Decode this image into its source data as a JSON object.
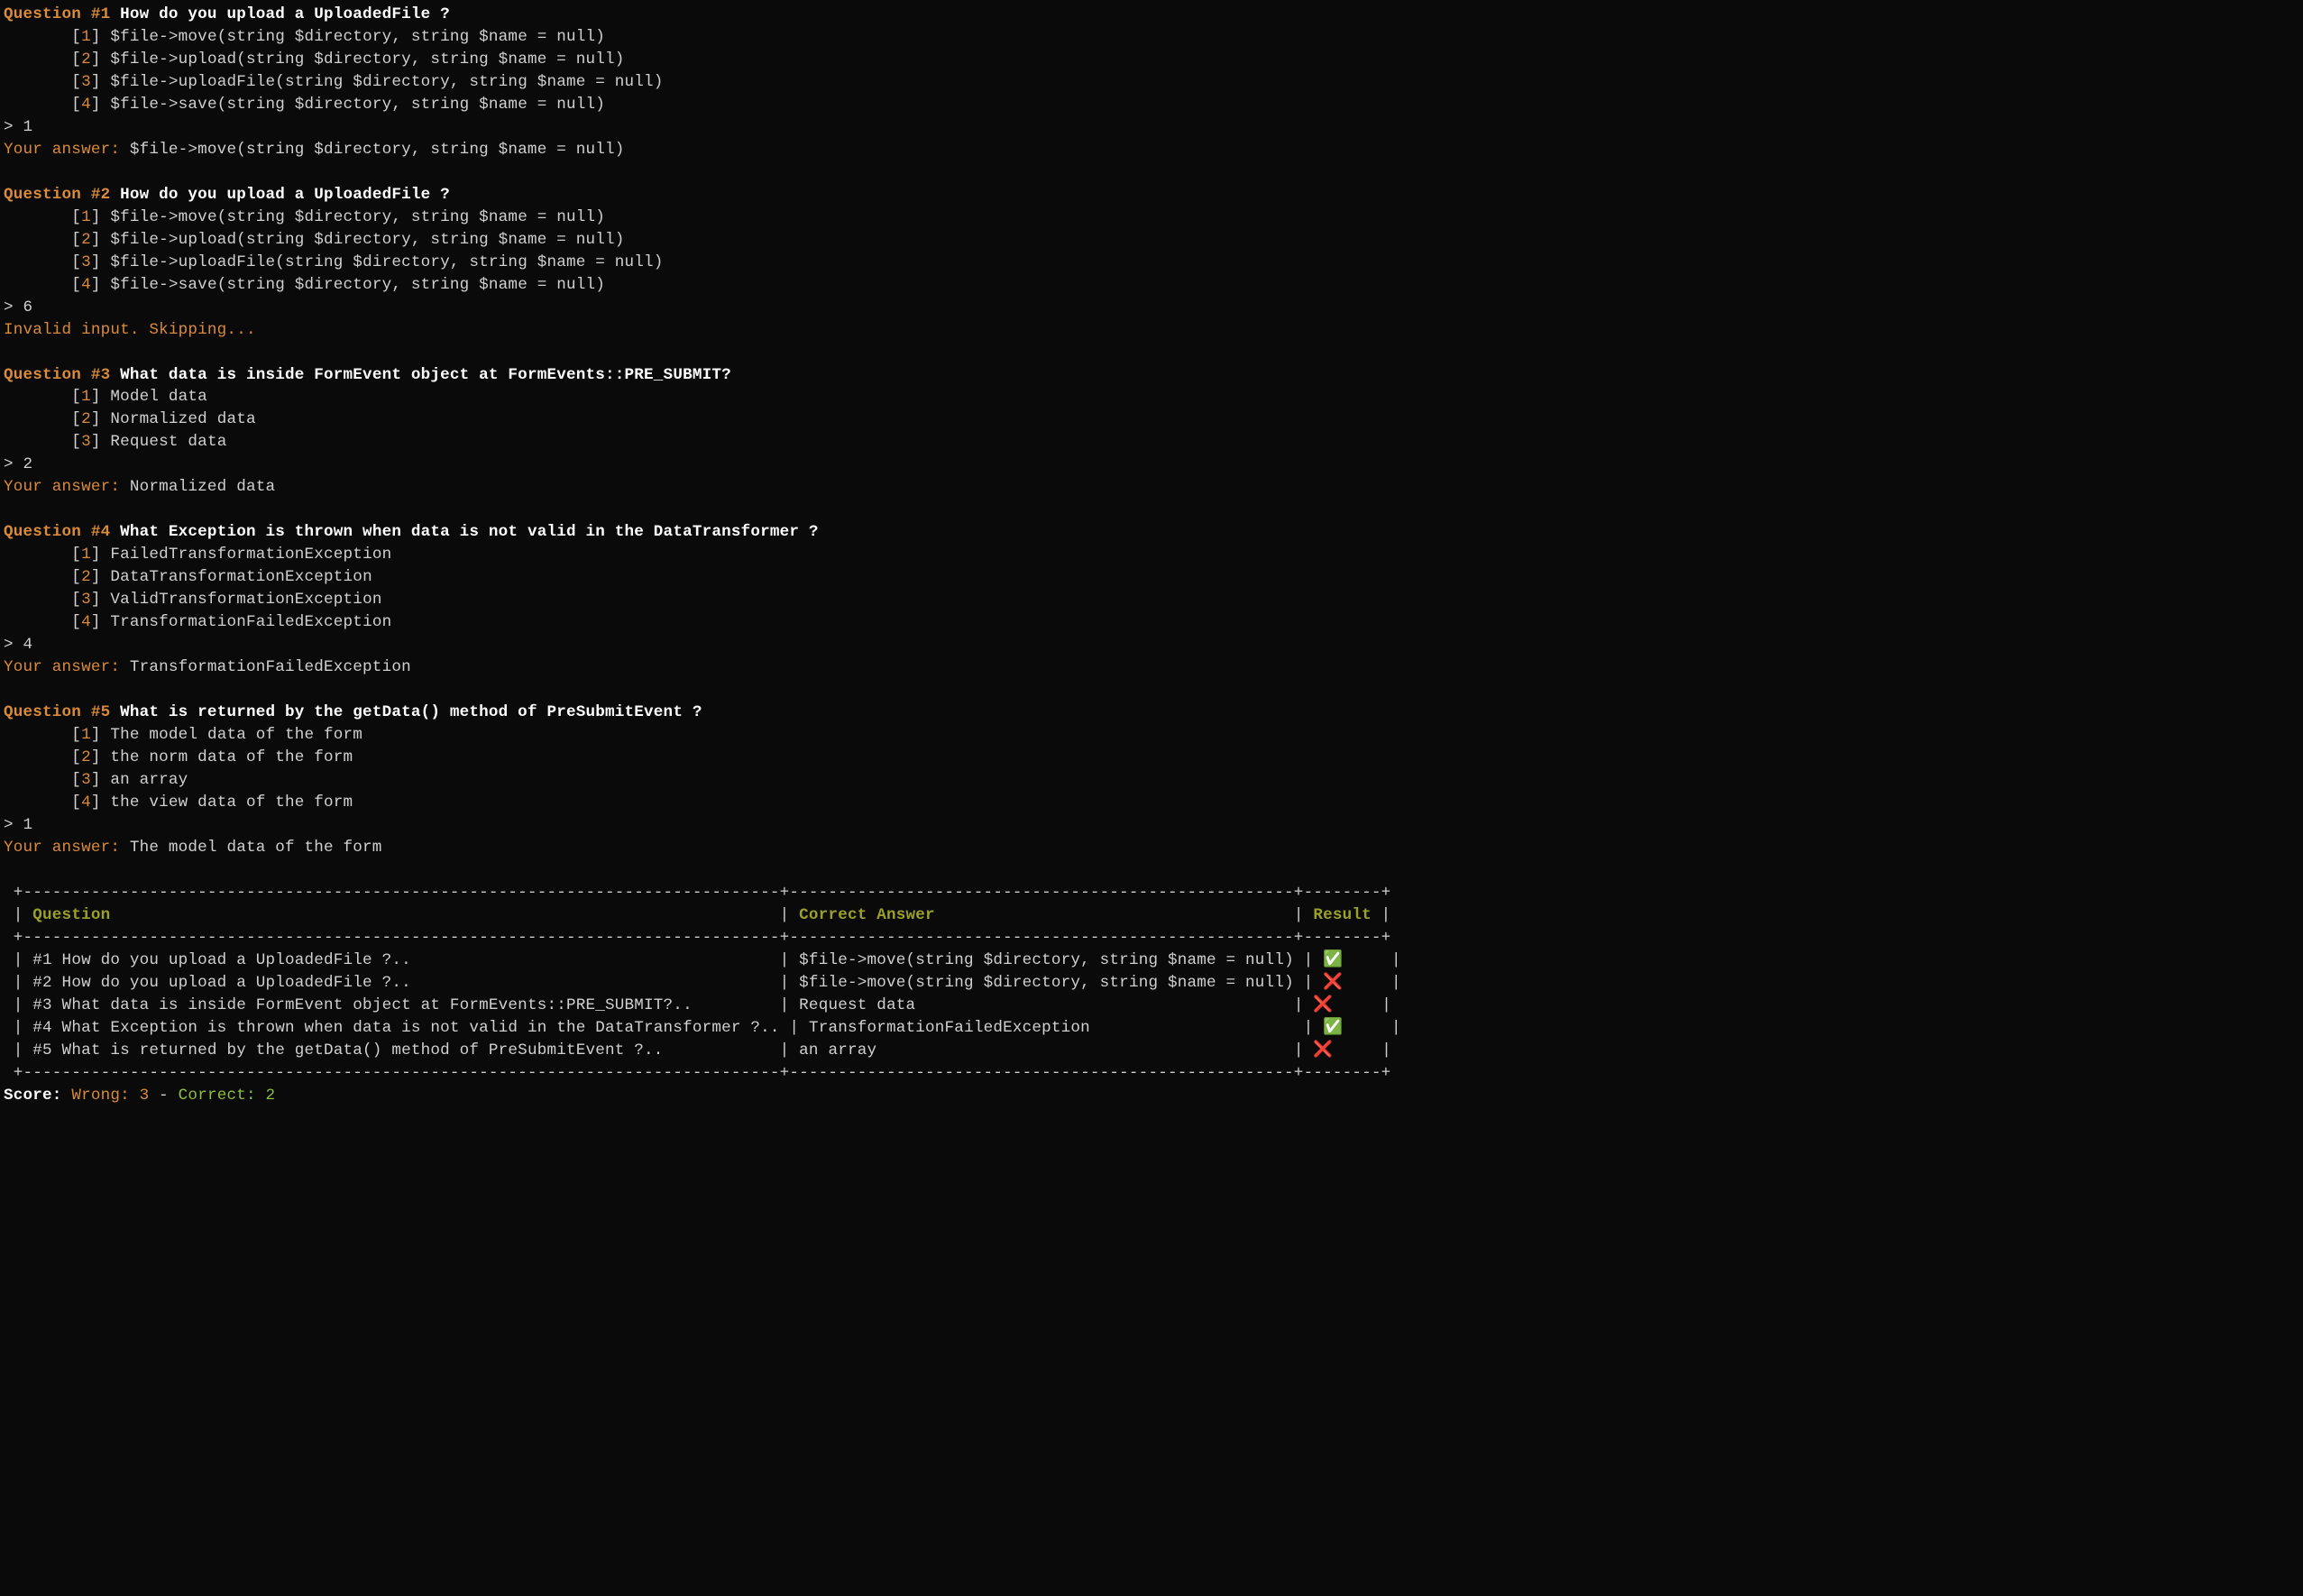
{
  "questions": [
    {
      "label": "Question #1",
      "text": "How do you upload a UploadedFile ?",
      "options": [
        {
          "n": "1",
          "text": "$file->move(string $directory, string $name = null)"
        },
        {
          "n": "2",
          "text": "$file->upload(string $directory, string $name = null)"
        },
        {
          "n": "3",
          "text": "$file->uploadFile(string $directory, string $name = null)"
        },
        {
          "n": "4",
          "text": "$file->save(string $directory, string $name = null)"
        }
      ],
      "input": "1",
      "feedback_prefix": "Your answer: ",
      "feedback": "$file->move(string $directory, string $name = null)",
      "feedback_style": "grey"
    },
    {
      "label": "Question #2",
      "text": "How do you upload a UploadedFile ?",
      "options": [
        {
          "n": "1",
          "text": "$file->move(string $directory, string $name = null)"
        },
        {
          "n": "2",
          "text": "$file->upload(string $directory, string $name = null)"
        },
        {
          "n": "3",
          "text": "$file->uploadFile(string $directory, string $name = null)"
        },
        {
          "n": "4",
          "text": "$file->save(string $directory, string $name = null)"
        }
      ],
      "input": "6",
      "feedback_prefix": "",
      "feedback": "Invalid input. Skipping...",
      "feedback_style": "orange"
    },
    {
      "label": "Question #3",
      "text": "What data is inside FormEvent object at FormEvents::PRE_SUBMIT?",
      "options": [
        {
          "n": "1",
          "text": "Model data"
        },
        {
          "n": "2",
          "text": "Normalized data"
        },
        {
          "n": "3",
          "text": "Request data"
        }
      ],
      "input": "2",
      "feedback_prefix": "Your answer: ",
      "feedback": "Normalized data",
      "feedback_style": "grey"
    },
    {
      "label": "Question #4",
      "text": "What Exception is thrown when data is not valid in the DataTransformer ?",
      "options": [
        {
          "n": "1",
          "text": "FailedTransformationException"
        },
        {
          "n": "2",
          "text": "DataTransformationException"
        },
        {
          "n": "3",
          "text": "ValidTransformationException"
        },
        {
          "n": "4",
          "text": "TransformationFailedException"
        }
      ],
      "input": "4",
      "feedback_prefix": "Your answer: ",
      "feedback": "TransformationFailedException",
      "feedback_style": "grey"
    },
    {
      "label": "Question #5",
      "text": "What is returned by the getData() method of PreSubmitEvent ?",
      "options": [
        {
          "n": "1",
          "text": "The model data of the form"
        },
        {
          "n": "2",
          "text": "the norm data of the form"
        },
        {
          "n": "3",
          "text": "an array"
        },
        {
          "n": "4",
          "text": "the view data of the form"
        }
      ],
      "input": "1",
      "feedback_prefix": "Your answer: ",
      "feedback": "The model data of the form",
      "feedback_style": "grey"
    }
  ],
  "table": {
    "col_widths": {
      "q": 78,
      "a": 52,
      "r": 8
    },
    "headers": {
      "q": "Question",
      "a": "Correct Answer",
      "r": "Result"
    },
    "rows": [
      {
        "idx": "#1",
        "q": "How do you upload a UploadedFile ?..",
        "a": "$file->move(string $directory, string $name = null)",
        "r": "check"
      },
      {
        "idx": "#2",
        "q": "How do you upload a UploadedFile ?..",
        "a": "$file->move(string $directory, string $name = null)",
        "r": "cross"
      },
      {
        "idx": "#3",
        "q": "What data is inside FormEvent object at FormEvents::PRE_SUBMIT?..",
        "a": "Request data",
        "r": "cross"
      },
      {
        "idx": "#4",
        "q": "What Exception is thrown when data is not valid in the DataTransformer ?..",
        "a": "TransformationFailedException",
        "r": "check"
      },
      {
        "idx": "#5",
        "q": "What is returned by the getData() method of PreSubmitEvent ?..",
        "a": "an array",
        "r": "cross"
      }
    ]
  },
  "score": {
    "label": "Score:",
    "wrong_label": "Wrong: ",
    "wrong_n": "3",
    "sep": " - ",
    "correct_label": "Correct: ",
    "correct_n": "2"
  },
  "icons": {
    "check": "✅",
    "cross": "❌"
  },
  "prompt": "> ",
  "option_indent": "       "
}
